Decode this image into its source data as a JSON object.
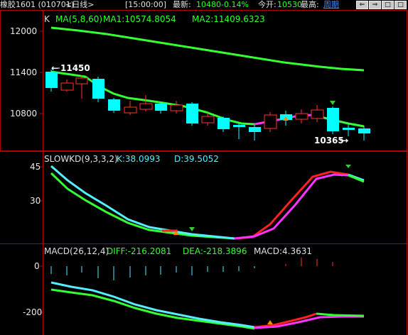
{
  "header": {
    "instrument": "橡胶1601 (010701)",
    "period": "<日线>",
    "time": "[15:00:00]",
    "latest_label": "最新:",
    "latest_value": "10480",
    "change_pct": "-0.14%",
    "open_label": "今开:",
    "open_value": "10530",
    "high_label": "最高:",
    "high_value": "周期",
    "nav_left": "⇐",
    "nav_right": "⇒",
    "nav_box": "□"
  },
  "panels": {
    "kline": {
      "k_label": "K",
      "ma_label": "MA(5,8,60)",
      "ma1": "MA1:10574.8054",
      "ma2": "MA2:11409.6323",
      "ticks": [
        "12000",
        "11400",
        "10800"
      ],
      "high_marker": "11450",
      "low_marker": "10365"
    },
    "slowkd": {
      "name": "SLOWKD(9,3,3,2)",
      "k": "K:38.0993",
      "d": "D:39.5052",
      "ticks": [
        "45",
        "30"
      ]
    },
    "macd": {
      "name": "MACD(26,12,4)",
      "diff": "DIFF:-216.2081",
      "dea": "DEA:-218.3896",
      "macd": "MACD:4.3631",
      "ticks": [
        "0",
        "-200"
      ]
    }
  },
  "colors": {
    "bg": "#000000",
    "up": "#ff3232",
    "down": "#00ffff",
    "ma_green": "#33ff33",
    "ma_magenta": "#ff33ff",
    "macd_cyan": "#55eeff",
    "grid": "#b00000"
  }
}
